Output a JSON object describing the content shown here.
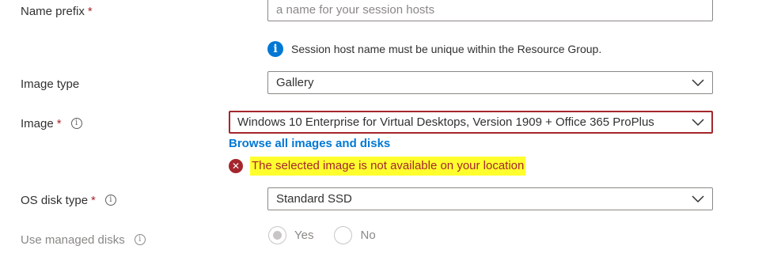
{
  "form": {
    "name_prefix": {
      "label": "Name prefix",
      "required_mark": "*",
      "value": "",
      "placeholder": "a name for your session hosts",
      "info_message": "Session host name must be unique within the Resource Group."
    },
    "image_type": {
      "label": "Image type",
      "selected": "Gallery"
    },
    "image": {
      "label": "Image",
      "required_mark": "*",
      "info_glyph": "i",
      "selected": "Windows 10 Enterprise for Virtual Desktops, Version 1909 + Office 365 ProPlus",
      "browse_link": "Browse all images and disks",
      "error_message": "The selected image is not available on your location",
      "error_glyph": "✕"
    },
    "os_disk_type": {
      "label": "OS disk type",
      "required_mark": "*",
      "info_glyph": "i",
      "selected": "Standard SSD"
    },
    "use_managed_disks": {
      "label": "Use managed disks",
      "info_glyph": "i",
      "options": [
        "Yes",
        "No"
      ],
      "selected": "Yes",
      "disabled": true
    }
  },
  "icons": {
    "info_glyph": "i",
    "chevron": "chevron-down-icon"
  },
  "colors": {
    "accent": "#0078d4",
    "error": "#a4262c",
    "highlight": "#ffff2e",
    "text": "#323130",
    "disabled_text": "#8a8886"
  }
}
